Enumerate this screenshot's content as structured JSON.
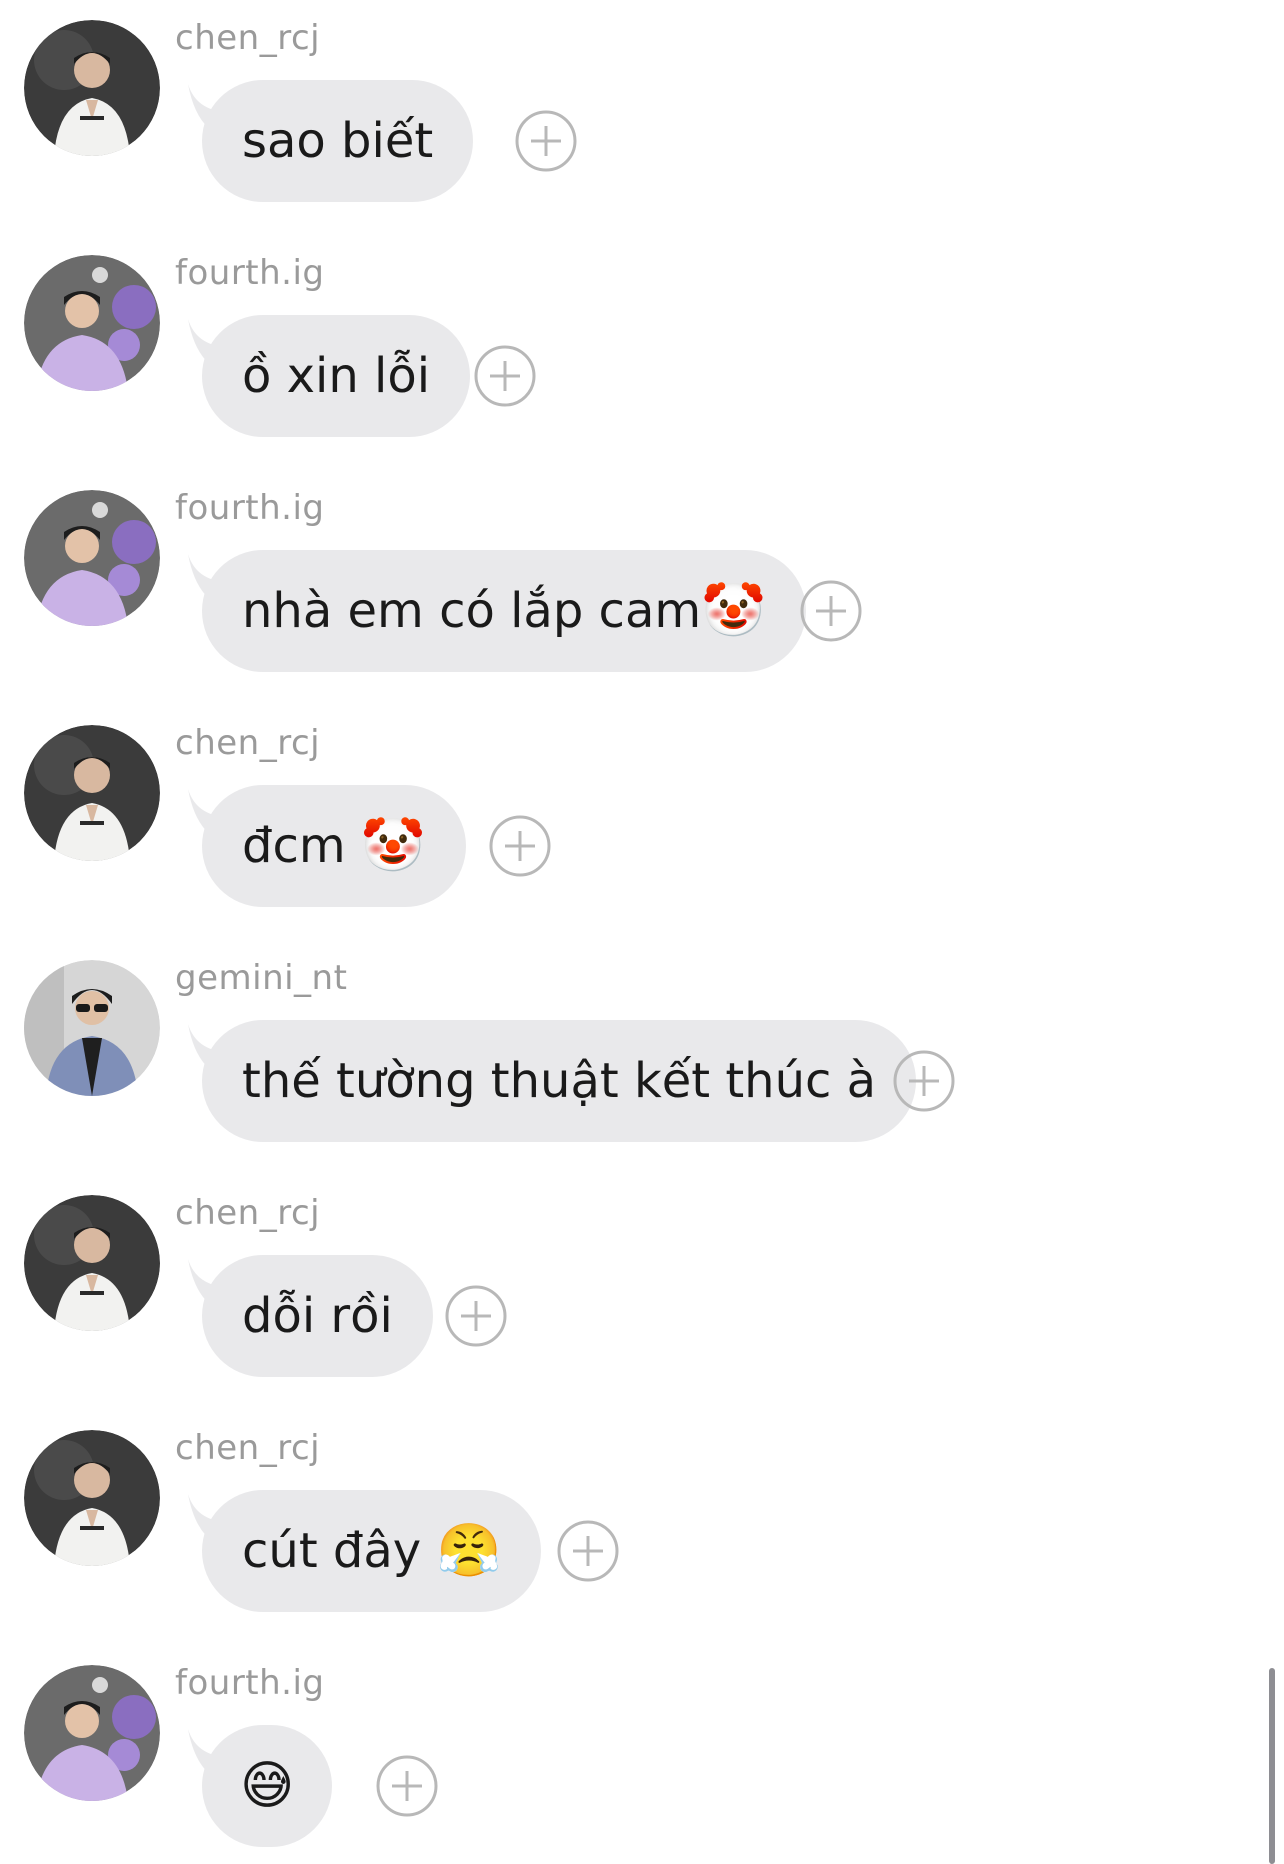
{
  "colors": {
    "bubble_bg": "#e9e9eb",
    "username": "#9a9a9a",
    "text": "#1a1a1a",
    "add_icon": "#b8b8b8"
  },
  "messages": [
    {
      "username": "chen_rcj",
      "avatar": "chen-avatar",
      "text": "sao biết",
      "emoji": ""
    },
    {
      "username": "fourth.ig",
      "avatar": "fourth-avatar",
      "text": "ồ xin lỗi",
      "emoji": ""
    },
    {
      "username": "fourth.ig",
      "avatar": "fourth-avatar",
      "text": "nhà em có lắp cam",
      "emoji": "🤡"
    },
    {
      "username": "chen_rcj",
      "avatar": "chen-avatar",
      "text": "đcm ",
      "emoji": "🤡"
    },
    {
      "username": "gemini_nt",
      "avatar": "gemini-avatar",
      "text": "thế tường thuật kết thúc à",
      "emoji": ""
    },
    {
      "username": "chen_rcj",
      "avatar": "chen-avatar",
      "text": "dỗi rồi",
      "emoji": ""
    },
    {
      "username": "chen_rcj",
      "avatar": "chen-avatar",
      "text": "cút đây ",
      "emoji": "😤"
    },
    {
      "username": "fourth.ig",
      "avatar": "fourth-avatar",
      "text": "",
      "emoji": "😅"
    }
  ]
}
